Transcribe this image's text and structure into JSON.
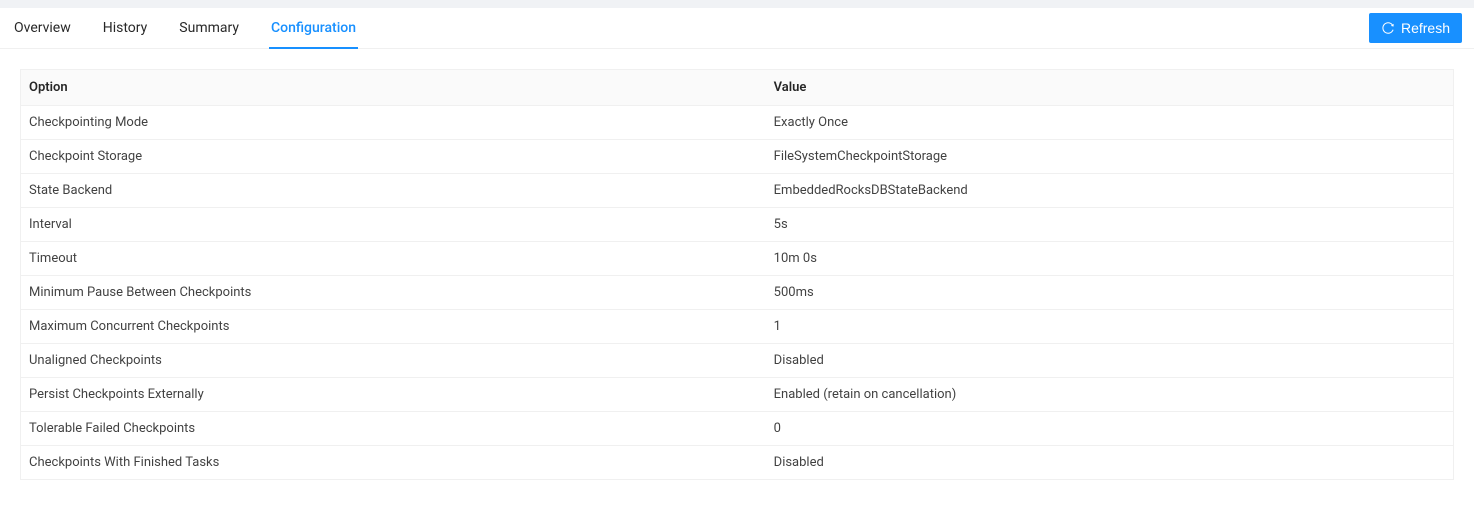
{
  "tabs": [
    {
      "label": "Overview",
      "active": false
    },
    {
      "label": "History",
      "active": false
    },
    {
      "label": "Summary",
      "active": false
    },
    {
      "label": "Configuration",
      "active": true
    }
  ],
  "refresh_label": "Refresh",
  "table": {
    "headers": {
      "option": "Option",
      "value": "Value"
    },
    "rows": [
      {
        "option": "Checkpointing Mode",
        "value": "Exactly Once"
      },
      {
        "option": "Checkpoint Storage",
        "value": "FileSystemCheckpointStorage"
      },
      {
        "option": "State Backend",
        "value": "EmbeddedRocksDBStateBackend"
      },
      {
        "option": "Interval",
        "value": "5s"
      },
      {
        "option": "Timeout",
        "value": "10m 0s"
      },
      {
        "option": "Minimum Pause Between Checkpoints",
        "value": "500ms"
      },
      {
        "option": "Maximum Concurrent Checkpoints",
        "value": "1"
      },
      {
        "option": "Unaligned Checkpoints",
        "value": "Disabled"
      },
      {
        "option": "Persist Checkpoints Externally",
        "value": "Enabled (retain on cancellation)"
      },
      {
        "option": "Tolerable Failed Checkpoints",
        "value": "0"
      },
      {
        "option": "Checkpoints With Finished Tasks",
        "value": "Disabled"
      }
    ]
  }
}
